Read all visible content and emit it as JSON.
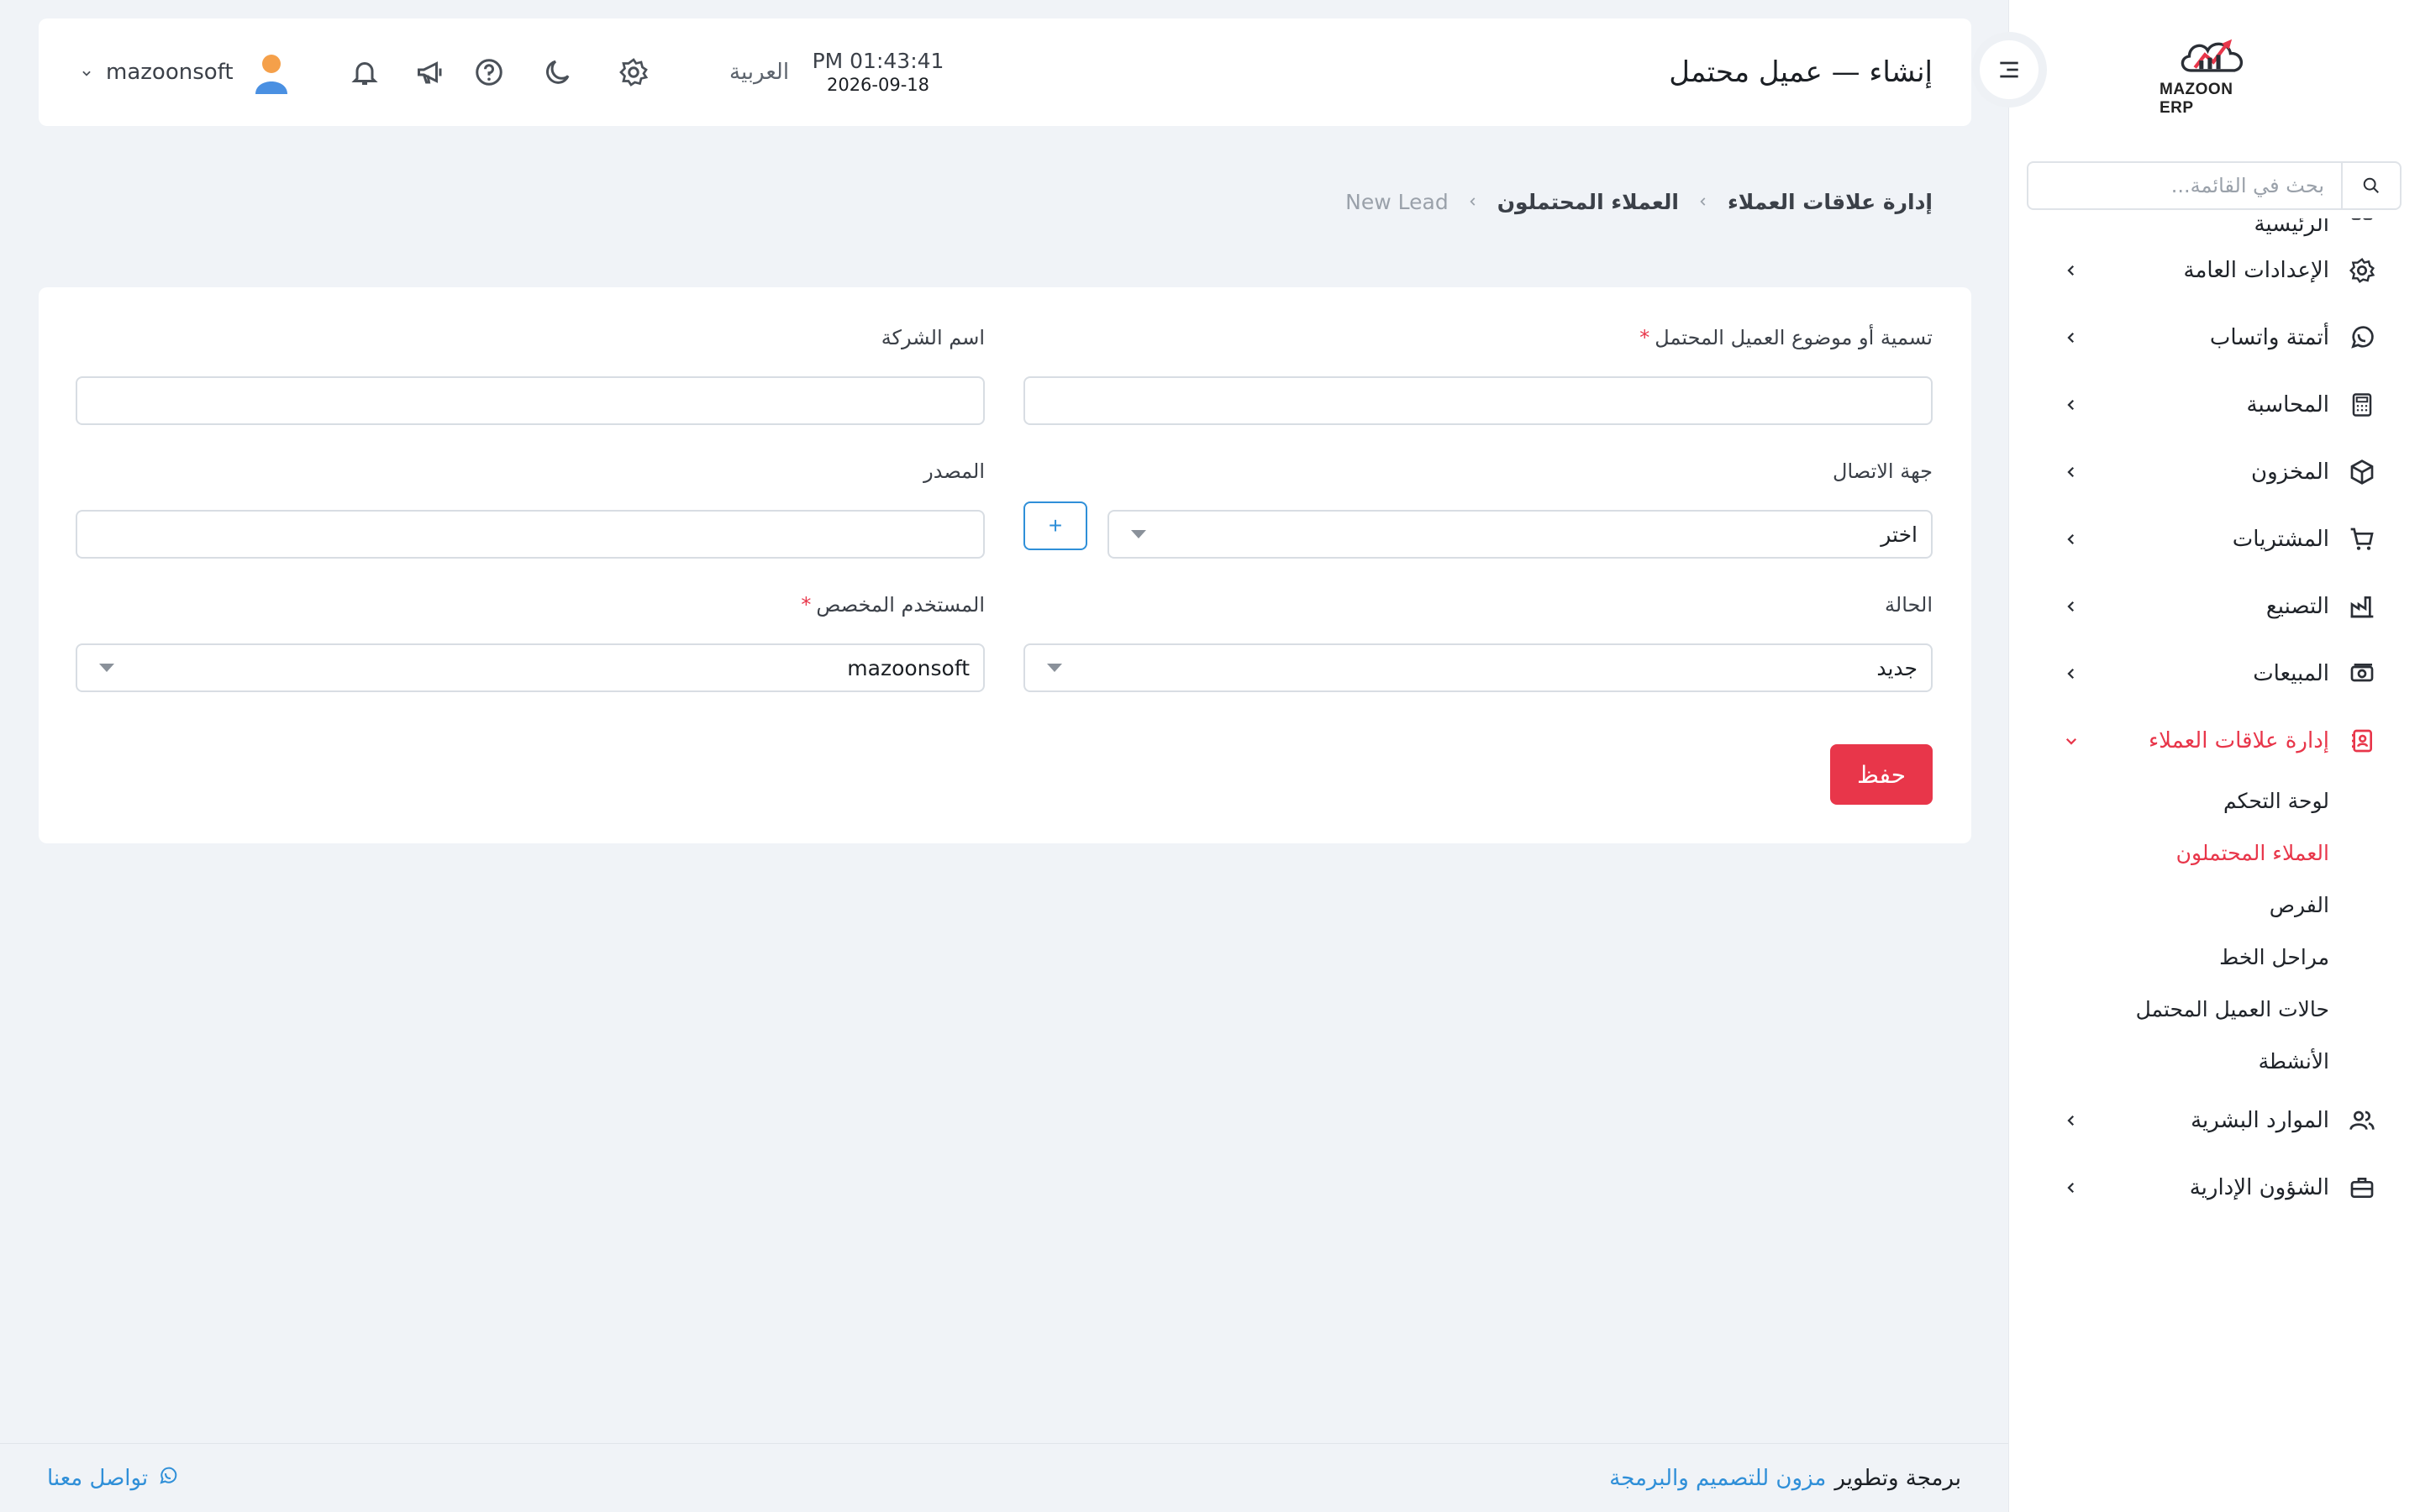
{
  "brand": {
    "name": "MAZOON ERP",
    "accent": "#e8364a",
    "link_color": "#2f8fd8"
  },
  "sidebar": {
    "search_placeholder": "بحث في القائمة...",
    "items": [
      {
        "label": "الرئيسية",
        "icon": "home-icon"
      },
      {
        "label": "الإعدادات العامة",
        "icon": "gear-icon"
      },
      {
        "label": "أتمتة واتساب",
        "icon": "whatsapp-icon"
      },
      {
        "label": "المحاسبة",
        "icon": "calculator-icon"
      },
      {
        "label": "المخزون",
        "icon": "box-icon"
      },
      {
        "label": "المشتريات",
        "icon": "cart-icon"
      },
      {
        "label": "التصنيع",
        "icon": "factory-icon"
      },
      {
        "label": "المبيعات",
        "icon": "cash-icon"
      },
      {
        "label": "إدارة علاقات العملاء",
        "icon": "contacts-icon",
        "active": true
      },
      {
        "label": "الموارد البشرية",
        "icon": "users-icon"
      },
      {
        "label": "الشؤون الإدارية",
        "icon": "briefcase-icon"
      }
    ],
    "crm_submenu": [
      {
        "label": "لوحة التحكم"
      },
      {
        "label": "العملاء المحتملون",
        "active": true
      },
      {
        "label": "الفرص"
      },
      {
        "label": "مراحل الخط"
      },
      {
        "label": "حالات العميل المحتمل"
      },
      {
        "label": "الأنشطة"
      }
    ]
  },
  "header": {
    "title": "إنشاء — عميل محتمل",
    "time": "PM 01:43:41",
    "date": "2026-09-18",
    "language": "العربية",
    "username": "mazoonsoft"
  },
  "breadcrumb": [
    "إدارة علاقات العملاء",
    "العملاء المحتملون",
    "New Lead"
  ],
  "form": {
    "lead_title_label": "تسمية أو موضوع العميل المحتمل",
    "lead_title_value": "",
    "company_label": "اسم الشركة",
    "company_value": "",
    "contact_label": "جهة الاتصال",
    "contact_value": "اختر",
    "add_contact_label": "+",
    "source_label": "المصدر",
    "source_value": "",
    "status_label": "الحالة",
    "status_value": "جديد",
    "assigned_label": "المستخدم المخصص",
    "assigned_value": "mazoonsoft",
    "required_mark": "*",
    "save_label": "حفظ"
  },
  "footer": {
    "credit_prefix": "برمجة وتطوير",
    "credit_link": "مزون للتصميم والبرمجة",
    "contact_label": "تواصل معنا"
  }
}
